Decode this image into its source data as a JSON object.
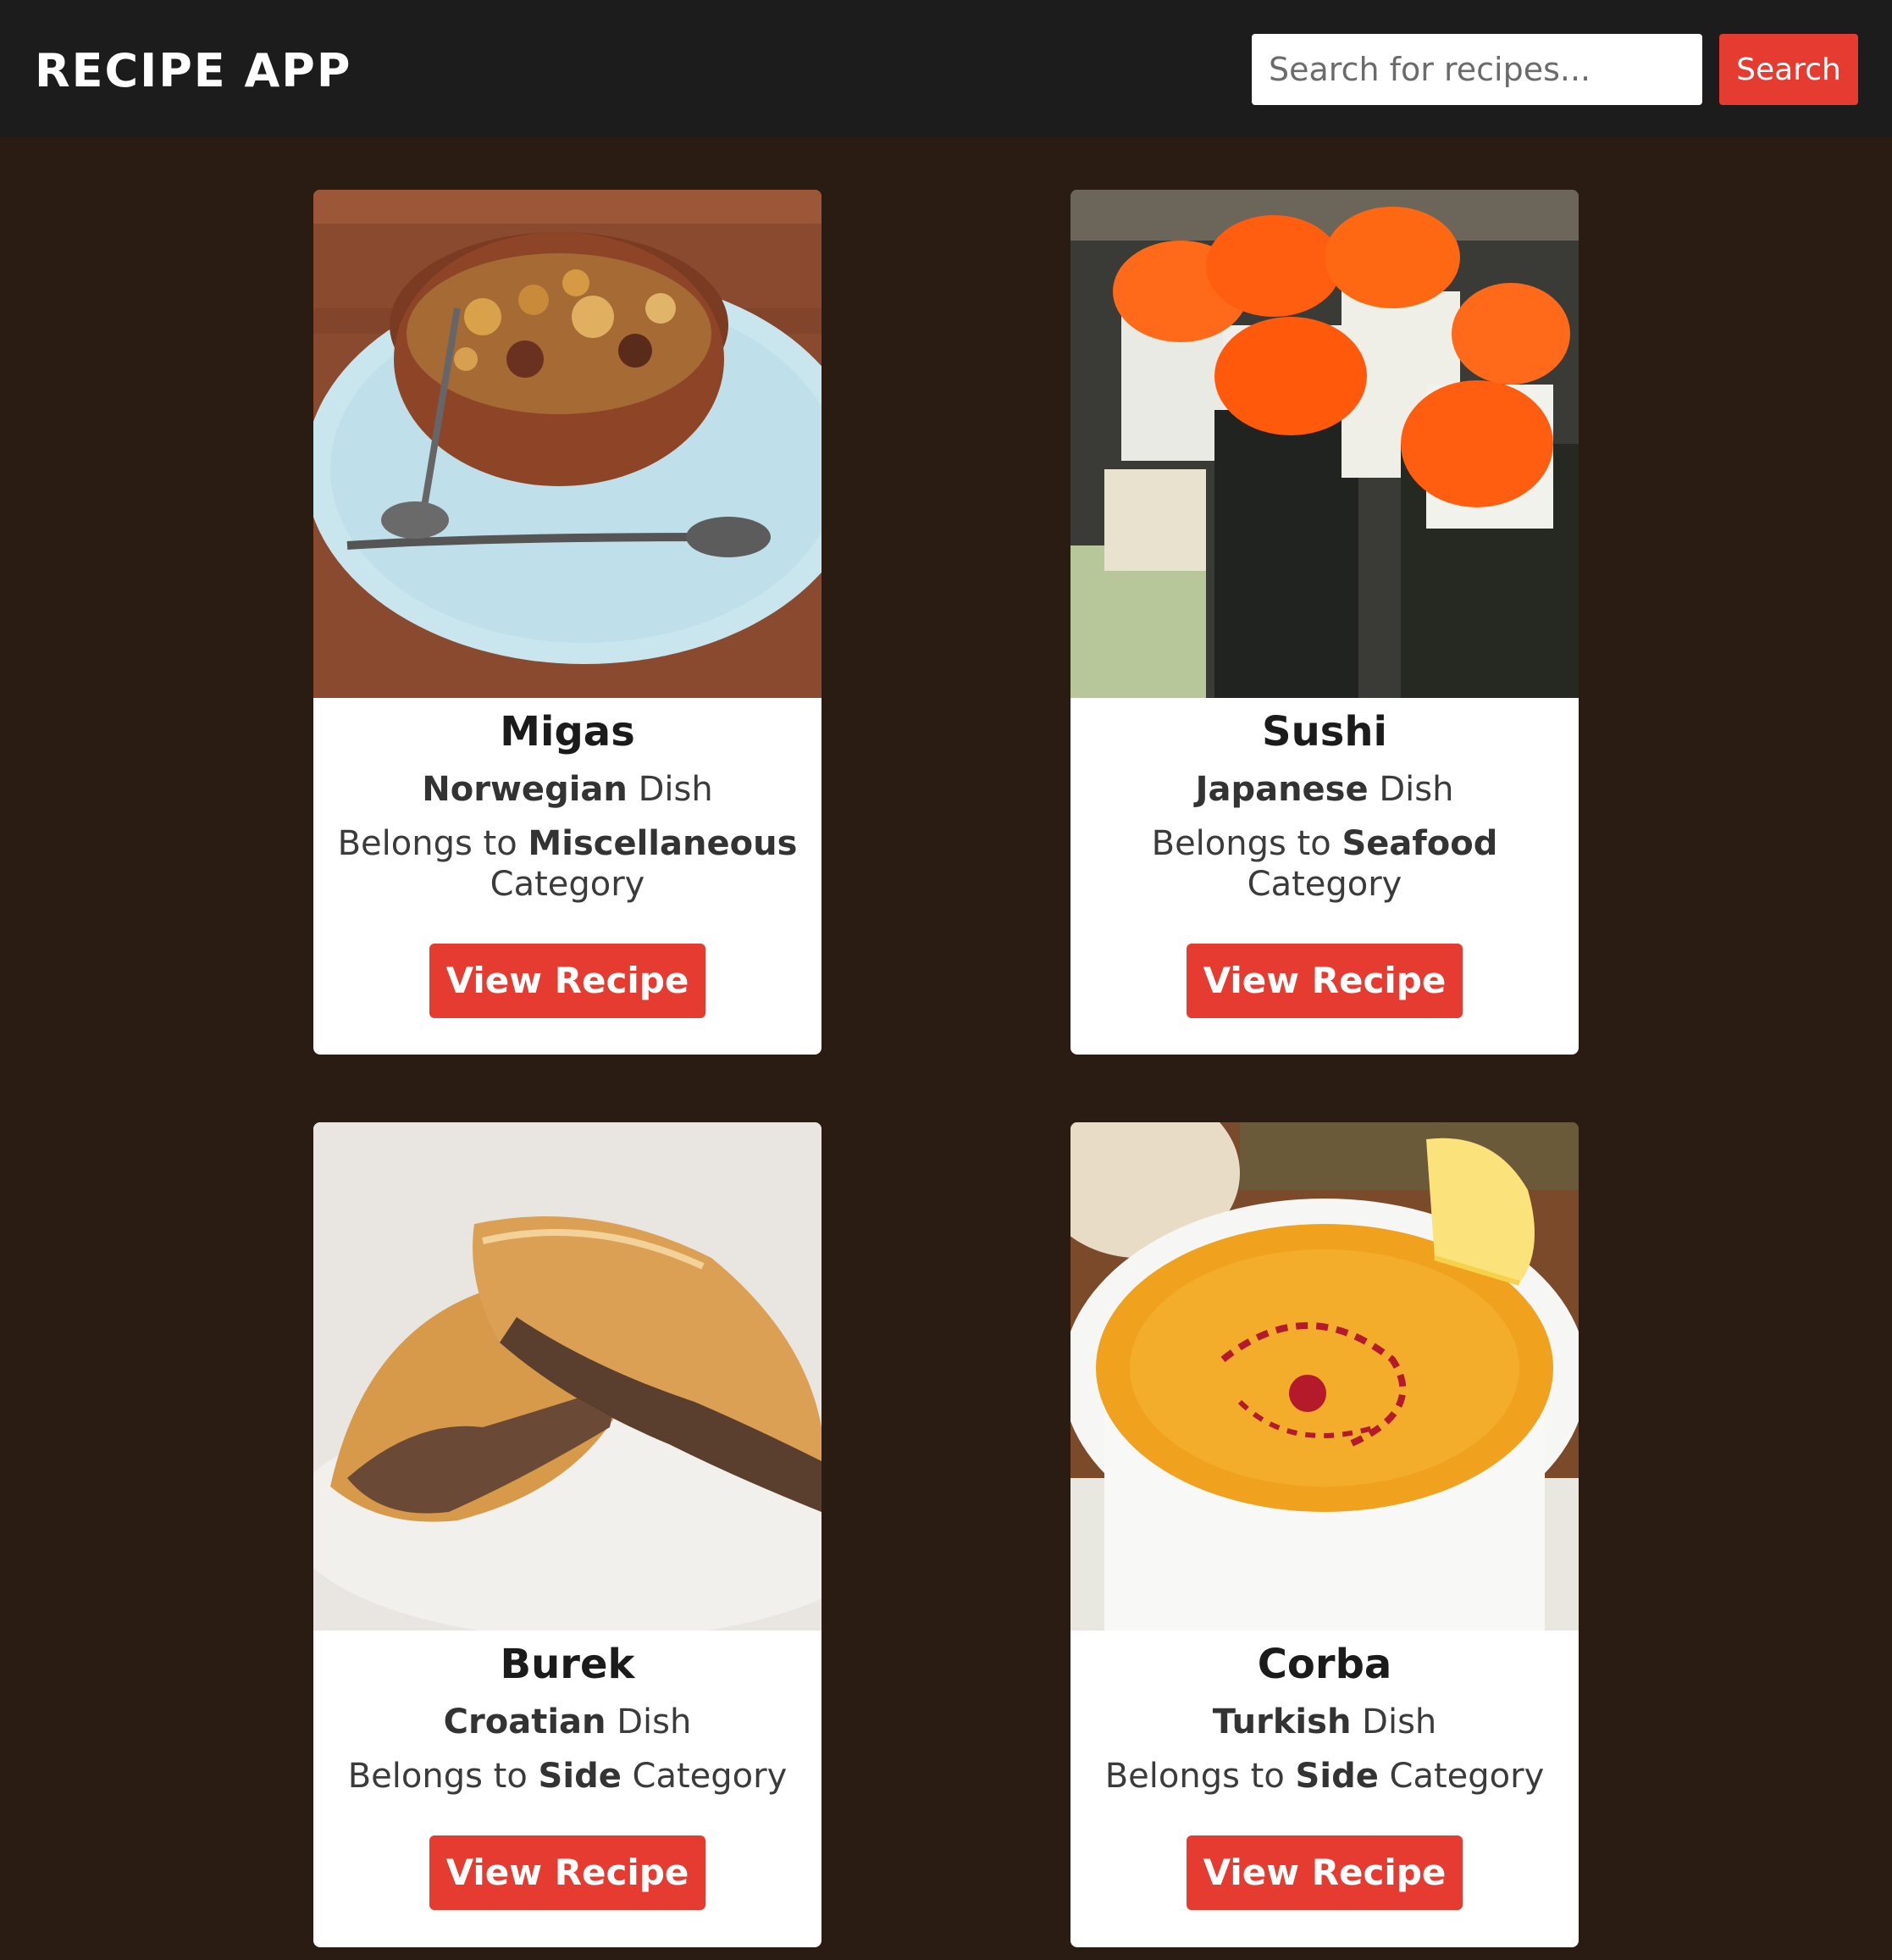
{
  "header": {
    "brand": "RECIPE APP",
    "search_placeholder": "Search for recipes...",
    "search_button": "Search"
  },
  "recipes": [
    {
      "name": "Migas",
      "area": "Norwegian",
      "dish_word": " Dish",
      "belongs_prefix": "Belongs to ",
      "category": "Miscellaneous",
      "category_suffix": " Category",
      "button": "View Recipe",
      "image_icon": "migas-bowl-image"
    },
    {
      "name": "Sushi",
      "area": "Japanese",
      "dish_word": " Dish",
      "belongs_prefix": "Belongs to ",
      "category": "Seafood",
      "category_suffix": " Category",
      "button": "View Recipe",
      "image_icon": "sushi-rolls-image"
    },
    {
      "name": "Burek",
      "area": "Croatian",
      "dish_word": " Dish",
      "belongs_prefix": "Belongs to ",
      "category": "Side",
      "category_suffix": " Category",
      "button": "View Recipe",
      "image_icon": "burek-pastry-image"
    },
    {
      "name": "Corba",
      "area": "Turkish",
      "dish_word": " Dish",
      "belongs_prefix": "Belongs to ",
      "category": "Side",
      "category_suffix": " Category",
      "button": "View Recipe",
      "image_icon": "corba-soup-image"
    }
  ]
}
